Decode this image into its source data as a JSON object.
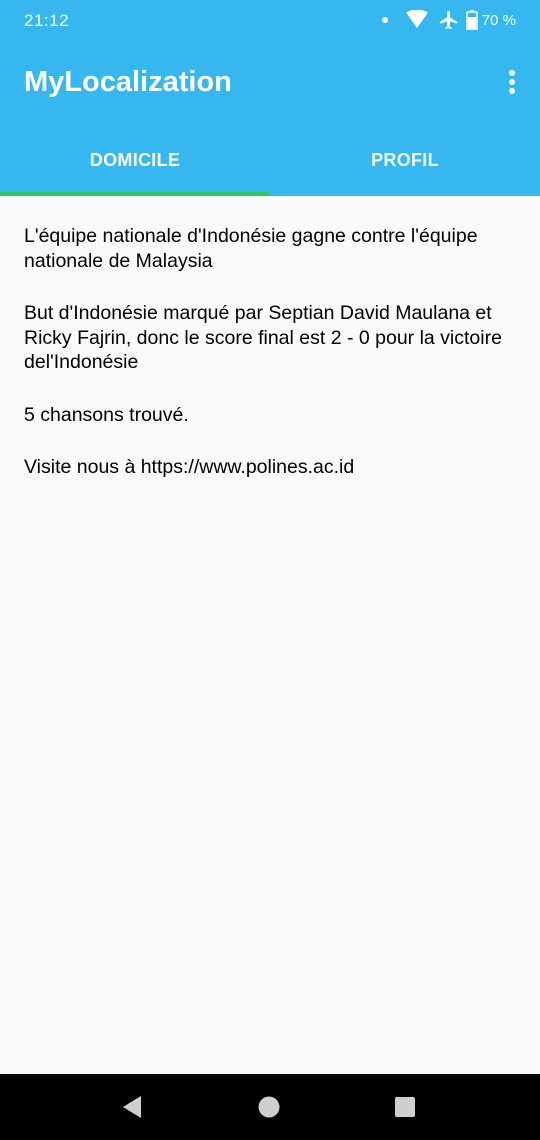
{
  "status_bar": {
    "time": "21:12",
    "battery": "70 %"
  },
  "app": {
    "title": "MyLocalization"
  },
  "tabs": [
    {
      "label": "DOMICILE",
      "selected": true
    },
    {
      "label": "PROFIL",
      "selected": false
    }
  ],
  "content": {
    "paragraphs": [
      "L'équipe nationale d'Indonésie gagne contre l'équipe nationale de Malaysia",
      "But d'Indonésie marqué par Septian David Maulana et Ricky Fajrin, donc le score final est 2 - 0 pour la victoire del'Indonésie",
      "5 chansons trouvé.",
      "Visite nous à https://www.polines.ac.id"
    ]
  },
  "colors": {
    "app_bar": "#36b7ef",
    "tab_indicator": "#35c46a",
    "background": "#fafafa",
    "nav_bar": "#000000"
  },
  "icons": {
    "status": [
      "notification-dot-icon",
      "wifi-icon",
      "airplane-mode-icon",
      "battery-icon"
    ],
    "toolbar": [
      "overflow-menu-icon"
    ],
    "navigation": [
      "back-icon",
      "home-icon",
      "recents-icon"
    ]
  }
}
